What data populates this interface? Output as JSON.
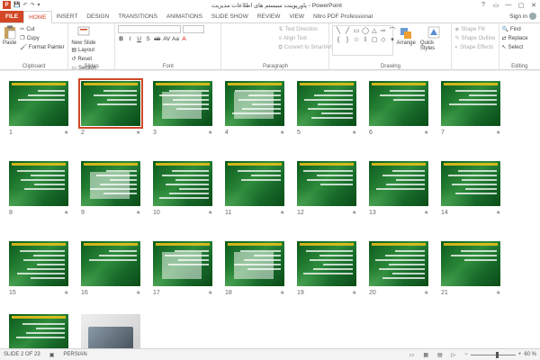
{
  "window": {
    "title": "پاورپوینت سیستم های اطلاعات مدیریت - PowerPoint",
    "controls": [
      "?",
      "▭",
      "—",
      "▢",
      "✕"
    ]
  },
  "qat": {
    "logo": "P",
    "items": [
      "💾",
      "↶",
      "↷",
      "▾"
    ]
  },
  "tabs": {
    "file": "FILE",
    "items": [
      "HOME",
      "INSERT",
      "DESIGN",
      "TRANSITIONS",
      "ANIMATIONS",
      "SLIDE SHOW",
      "REVIEW",
      "VIEW",
      "Nitro PDF Professional"
    ],
    "active": "HOME",
    "signin": "Sign in"
  },
  "ribbon": {
    "clipboard": {
      "label": "Clipboard",
      "paste": "Paste",
      "cut": "Cut",
      "copy": "Copy",
      "format_painter": "Format Painter"
    },
    "slides": {
      "label": "Slides",
      "new_slide": "New Slide",
      "layout": "Layout",
      "reset": "Reset",
      "section": "Section"
    },
    "font": {
      "label": "Font",
      "format_buttons": [
        "B",
        "I",
        "U",
        "S",
        "ab",
        "AV",
        "Aa",
        "A"
      ]
    },
    "paragraph": {
      "label": "Paragraph",
      "text_direction": "Text Direction",
      "align_text": "Align Text",
      "convert_smartart": "Convert to SmartArt"
    },
    "drawing": {
      "label": "Drawing",
      "arrange": "Arrange",
      "quick_styles": "Quick Styles",
      "shape_fill": "Shape Fill",
      "shape_outline": "Shape Outline",
      "shape_effects": "Shape Effects"
    },
    "editing": {
      "label": "Editing",
      "find": "Find",
      "replace": "Replace",
      "select": "Select"
    }
  },
  "slides": [
    {
      "num": "1"
    },
    {
      "num": "2"
    },
    {
      "num": "3"
    },
    {
      "num": "4"
    },
    {
      "num": "5"
    },
    {
      "num": "6"
    },
    {
      "num": "7"
    },
    {
      "num": "8"
    },
    {
      "num": "9"
    },
    {
      "num": "10"
    },
    {
      "num": "11"
    },
    {
      "num": "12"
    },
    {
      "num": "13"
    },
    {
      "num": "14"
    },
    {
      "num": "15"
    },
    {
      "num": "16"
    },
    {
      "num": "17"
    },
    {
      "num": "18"
    },
    {
      "num": "19"
    },
    {
      "num": "20"
    },
    {
      "num": "21"
    },
    {
      "num": "22"
    },
    {
      "num": "23"
    }
  ],
  "selected_slide": "2",
  "star_glyph": "★",
  "status": {
    "slide_info": "SLIDE 2 OF 23",
    "language": "PERSIAN",
    "zoom": "60 %",
    "zoom_level_percent": 60
  }
}
